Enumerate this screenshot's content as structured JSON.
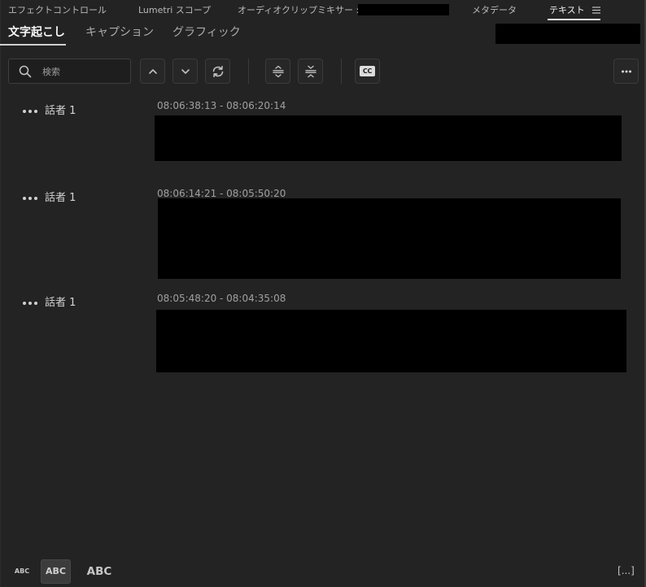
{
  "panel_tabs": [
    {
      "label": "エフェクトコントロール",
      "active": false
    },
    {
      "label": "Lumetri スコープ",
      "active": false
    },
    {
      "label": "オーディオクリップミキサー :",
      "active": false
    },
    {
      "label": "メタデータ",
      "active": false
    },
    {
      "label": "テキスト",
      "active": true
    }
  ],
  "panel_menu_icon": "hamburger-menu-icon",
  "sub_tabs": [
    {
      "label": "文字起こし",
      "active": true
    },
    {
      "label": "キャプション",
      "active": false
    },
    {
      "label": "グラフィック",
      "active": false
    }
  ],
  "toolbar": {
    "search": {
      "icon": "search-icon",
      "placeholder": "検索"
    },
    "buttons": [
      {
        "icon": "chevron-up-icon"
      },
      {
        "icon": "chevron-down-icon"
      },
      {
        "icon": "sync-icon"
      },
      {
        "icon": "expand-all-icon"
      },
      {
        "icon": "collapse-all-icon"
      },
      {
        "icon": "closed-captions-icon",
        "label": "CC"
      },
      {
        "icon": "more-icon"
      }
    ]
  },
  "transcript": {
    "speaker_menu_icon": "more-dots-icon",
    "segments": [
      {
        "speaker": "話者 1",
        "timecode": "08:06:38:13 - 08:06:20:14"
      },
      {
        "speaker": "話者 1",
        "timecode": "08:06:14:21 - 08:05:50:20"
      },
      {
        "speaker": "話者 1",
        "timecode": "08:05:48:20 - 08:04:35:08"
      }
    ]
  },
  "footer": {
    "text_size_options": [
      {
        "label": "ABC",
        "selected": false
      },
      {
        "label": "ABC",
        "selected": true
      },
      {
        "label": "ABC",
        "selected": false
      }
    ],
    "pause_markers_toggle": {
      "label": "[...]"
    }
  },
  "colors": {
    "background": "#232323",
    "active_tab_underline": "#e6e6e6",
    "timecode_text": "#a0a0a0",
    "redaction": "#000000"
  }
}
